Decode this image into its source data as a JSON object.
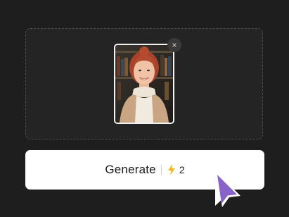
{
  "upload": {
    "remove_label": "×"
  },
  "generate_button": {
    "label": "Generate",
    "credit_cost": "2",
    "credit_icon": "lightning-bolt-icon"
  },
  "colors": {
    "background": "#1e1e1e",
    "dropzone": "#242424",
    "button": "#ffffff",
    "bolt": "#f5b820",
    "cursor": "#8a63c9"
  }
}
